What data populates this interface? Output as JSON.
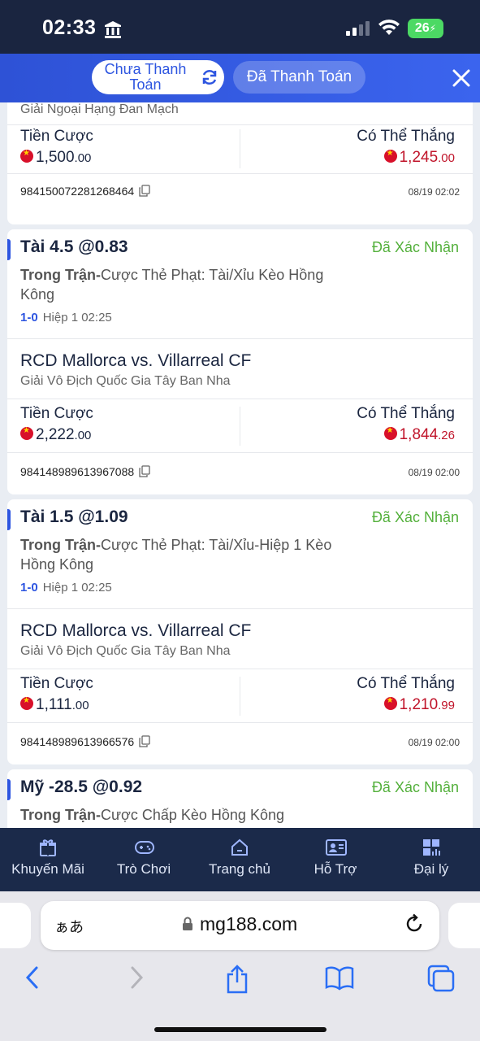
{
  "status_bar": {
    "time": "02:33",
    "battery": "26"
  },
  "header": {
    "tab_unpaid": "Chưa Thanh Toán",
    "tab_paid": "Đã Thanh Toán"
  },
  "first_card": {
    "league": "Giải Ngoại Hạng Đan Mạch",
    "stake_label": "Tiền Cược",
    "stake_int": "1,500",
    "stake_dec": ".00",
    "win_label": "Có Thể Thắng",
    "win_int": "1,245",
    "win_dec": ".00",
    "ticket_id": "984150072281268464",
    "date": "08/19 02:02"
  },
  "bets": [
    {
      "selection": "Tài 4.5 @0.83",
      "status": "Đã Xác Nhận",
      "market_prefix": "Trong Trận-",
      "market": "Cược Thẻ Phạt: Tài/Xỉu Kèo Hồng Kông",
      "score": "1-0",
      "period": "Hiệp 1 02:25",
      "match": "RCD Mallorca vs. Villarreal CF",
      "league": "Giải Vô Địch Quốc Gia Tây Ban Nha",
      "stake_label": "Tiền Cược",
      "stake_int": "2,222",
      "stake_dec": ".00",
      "win_label": "Có Thể Thắng",
      "win_int": "1,844",
      "win_dec": ".26",
      "ticket_id": "984148989613967088",
      "date": "08/19 02:00"
    },
    {
      "selection": "Tài 1.5 @1.09",
      "status": "Đã Xác Nhận",
      "market_prefix": "Trong Trận-",
      "market": "Cược Thẻ Phạt: Tài/Xỉu-Hiệp 1 Kèo Hồng Kông",
      "score": "1-0",
      "period": "Hiệp 1 02:25",
      "match": "RCD Mallorca vs. Villarreal CF",
      "league": "Giải Vô Địch Quốc Gia Tây Ban Nha",
      "stake_label": "Tiền Cược",
      "stake_int": "1,111",
      "stake_dec": ".00",
      "win_label": "Có Thể Thắng",
      "win_int": "1,210",
      "win_dec": ".99",
      "ticket_id": "984148989613966576",
      "date": "08/19 02:00"
    },
    {
      "selection": "Mỹ -28.5 @0.92",
      "status": "Đã Xác Nhận",
      "market_prefix": "Trong Trận-",
      "market": "Cược Chấp Kèo Hồng Kông"
    }
  ],
  "bottom_nav": [
    "Khuyến Mãi",
    "Trò Chơi",
    "Trang chủ",
    "Hỗ Trợ",
    "Đại lý"
  ],
  "browser": {
    "aa": "ぁあ",
    "domain": "mg188.com"
  },
  "colors": {
    "accent": "#2d55e0",
    "confirmed": "#54b03c",
    "win": "#c0142a",
    "nav_bg": "#1b2a4a"
  }
}
